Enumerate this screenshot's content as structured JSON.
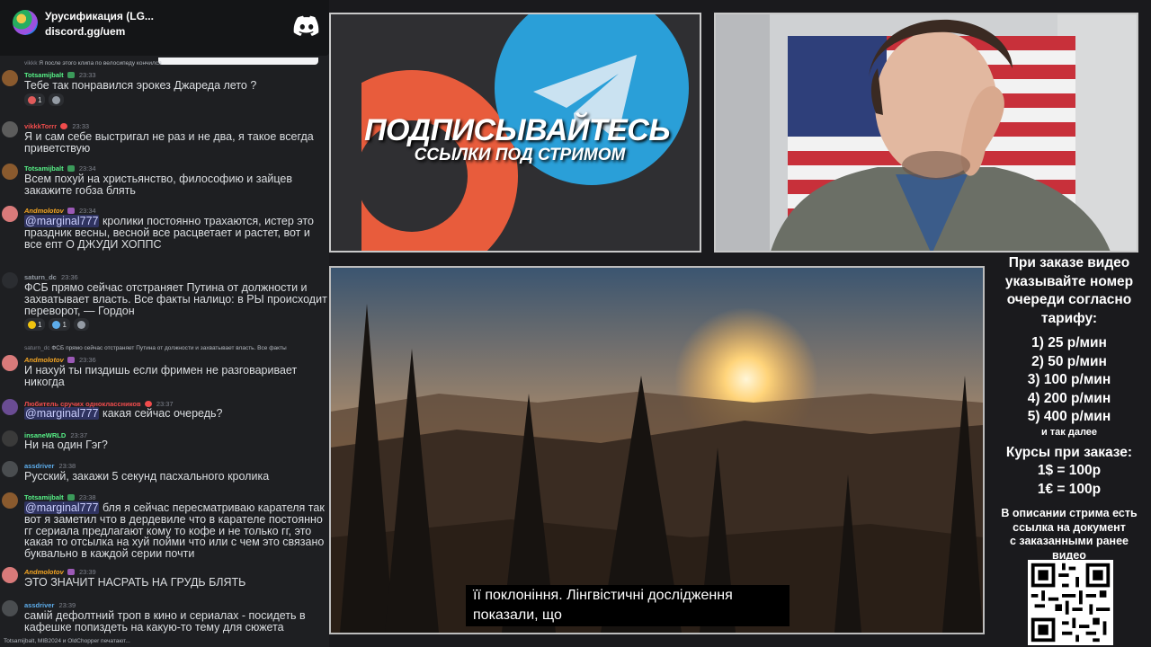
{
  "server": {
    "name": "Урусификация (LG...",
    "invite": "discord.gg/uem"
  },
  "chat": {
    "messages": [
      {
        "key": "m1",
        "reply": {
          "user": "vikkk",
          "text": "Я после этого клипа по велосипеду кончился"
        },
        "user": "Totsamijbalt",
        "time": "23:33",
        "text": "Тебе так понравился эрокез Джареда лето ?",
        "reactions": [
          {
            "count": "1"
          },
          {
            "count": ""
          }
        ]
      },
      {
        "key": "m2",
        "user": "vikkkTorrr",
        "time": "23:33",
        "text": "Я и сам себе выстригал не раз и не два, я такое всегда приветствую"
      },
      {
        "key": "m3",
        "user": "Totsamijbalt",
        "time": "23:34",
        "text": "Всем похуй на христьянство, философию и зайцев закажите гобза блять"
      },
      {
        "key": "m4",
        "user": "Andmolotov",
        "time": "23:34",
        "mention": "@marginal777",
        "text": " кролики постоянно трахаются, истер это праздник весны, весной все расцветает и растет, вот и все епт О ДЖУДИ ХОППС"
      },
      {
        "key": "m5",
        "user": "saturn_dc",
        "time": "23:36",
        "text": "ФСБ прямо сейчас отстраняет Путина от должности и захватывает власть. Все факты налицо: в РЫ происходит переворот, — Гордон",
        "reactions": [
          {
            "count": "1"
          },
          {
            "count": "1"
          },
          {
            "count": ""
          }
        ]
      },
      {
        "key": "m6",
        "reply": {
          "user": "saturn_dc",
          "text": "ФСБ прямо сейчас отстраняет Путина от должности и захватывает власть. Все факты"
        },
        "user": "Andmolotov",
        "time": "23:36",
        "text": "И нахуй ты пиздишь если фримен не разговаривает никогда"
      },
      {
        "key": "m7",
        "user": "Любитель сручих одноклассников",
        "time": "23:37",
        "mention": "@marginal777",
        "text": " какая сейчас очередь?"
      },
      {
        "key": "m8",
        "user": "insaneWRLD",
        "time": "23:37",
        "text": "Ни на один Гэг?"
      },
      {
        "key": "m9",
        "user": "assdriver",
        "time": "23:38",
        "text": "Русский, закажи 5 секунд пасхального кролика"
      },
      {
        "key": "m10",
        "user": "Totsamijbalt",
        "time": "23:38",
        "mention": "@marginal777",
        "text": " бля я сейчас пересматриваю карателя так вот я заметил что в дердевиле что в карателе постоянно гг сериала предлагают кому то кофе и не только гг, это какая то отсылка на хуй пойми что или с чем это связано буквально в каждой серии почти"
      },
      {
        "key": "m11",
        "user": "Andmolotov",
        "time": "23:39",
        "text": "ЭТО ЗНАЧИТ НАСРАТЬ НА ГРУДЬ БЛЯТЬ"
      },
      {
        "key": "m12",
        "user": "assdriver",
        "time": "23:39",
        "text": "самій дефолтний троп в кино и сериалах - посидеть в кафешке попиздеть на какую-то тему для сюжета"
      }
    ],
    "typing": "Totsamijbalt, MIB2024 и OldChopper печатают..."
  },
  "promo": {
    "title": "ПОДПИСЫВАЙТЕСЬ",
    "subtitle": "ССЫЛКИ ПОД СТРИМОМ"
  },
  "video": {
    "subtitle_line1": "її поклоніння. Лінгвістичні дослідження",
    "subtitle_line2": "показали, що"
  },
  "info": {
    "order_intro": [
      "При заказе видео",
      "указывайте номер",
      "очереди согласно",
      "тарифу:"
    ],
    "tariffs": [
      "1) 25 р/мин",
      "2) 50 р/мин",
      "3) 100 р/мин",
      "4) 200 р/мин",
      "5) 400 р/мин"
    ],
    "and_so_on": "и так далее",
    "rates_title": "Курсы при заказе:",
    "rates": [
      "1$ = 100р",
      "1€ = 100р"
    ],
    "description_note": [
      "В описании стрима есть",
      "ссылка на документ",
      "с заказанными ранее",
      "видео"
    ]
  },
  "colors": {
    "user_green": "#57f287",
    "user_red": "#f04c4c",
    "user_blue": "#5dadec",
    "user_gray": "#949ba4",
    "mention_fg": "#c9cdfb",
    "text": "#dbdee1",
    "timestamp": "#80848e"
  }
}
